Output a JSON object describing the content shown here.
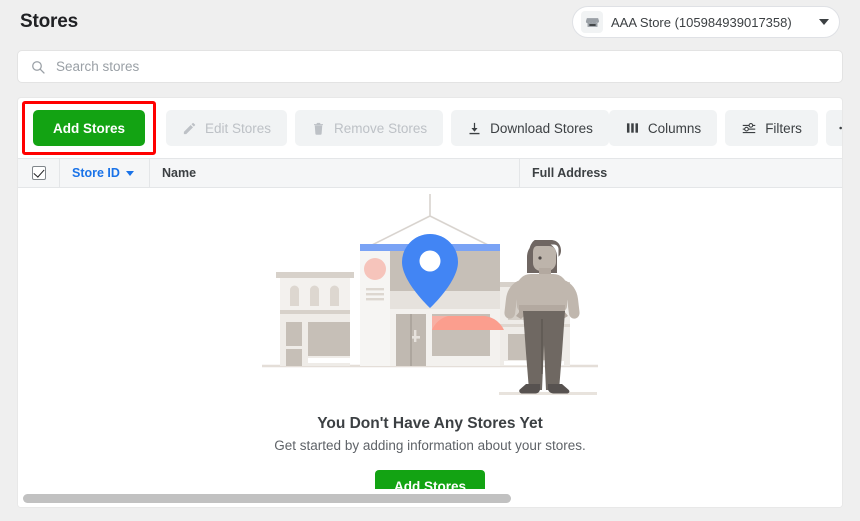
{
  "header": {
    "title": "Stores",
    "account": {
      "icon": "store-icon",
      "label": "AAA Store (105984939017358)",
      "caret": "chevron-down-icon"
    }
  },
  "search": {
    "icon": "search-icon",
    "placeholder": "Search stores",
    "value": ""
  },
  "toolbar": {
    "add_label": "Add Stores",
    "edit_label": "Edit Stores",
    "edit_icon": "pencil-icon",
    "remove_label": "Remove Stores",
    "remove_icon": "trash-icon",
    "download_label": "Download Stores",
    "download_icon": "download-icon",
    "columns_label": "Columns",
    "columns_icon": "columns-icon",
    "filters_label": "Filters",
    "filters_icon": "filters-icon",
    "overflow_label": "•••",
    "overflow_icon": "more-horizontal-icon"
  },
  "table": {
    "select_all_icon": "checkmark-icon",
    "columns": [
      {
        "key": "store_id",
        "label": "Store ID",
        "sorted": true,
        "sort_icon": "caret-down-icon"
      },
      {
        "key": "name",
        "label": "Name"
      },
      {
        "key": "full_address",
        "label": "Full Address"
      }
    ],
    "rows": []
  },
  "empty_state": {
    "illustration": "storefront-with-map-pin-illustration",
    "title": "You Don't Have Any Stores Yet",
    "subtitle": "Get started by adding information about your stores.",
    "cta_label": "Add Stores"
  },
  "scrollbar": {
    "orientation": "horizontal",
    "thumb_label": "horizontal-scroll-thumb"
  },
  "colors": {
    "accent_green": "#13a313",
    "link_blue": "#1a73e8",
    "pin_blue": "#4285f4",
    "annotation_red": "#ff0000",
    "page_bg": "#efefef"
  }
}
